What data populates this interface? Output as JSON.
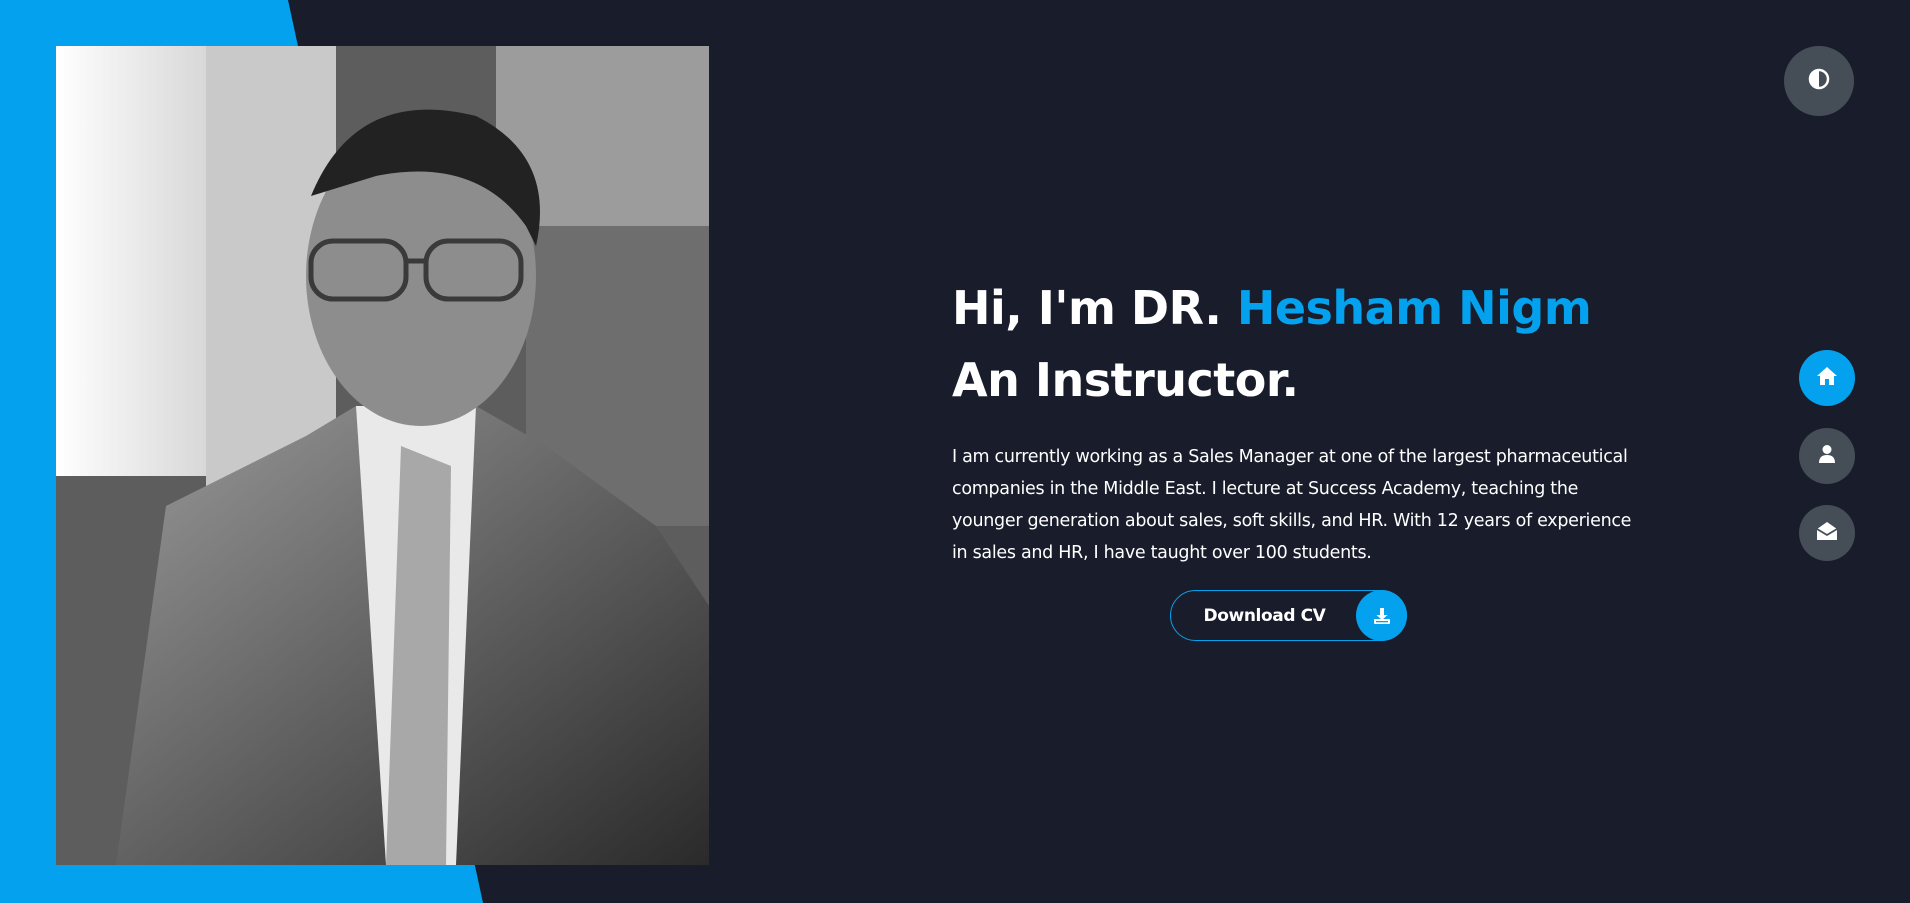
{
  "hero": {
    "greeting": "Hi, I'm DR. ",
    "name": "Hesham Nigm",
    "role": "An Instructor.",
    "bio": "I am currently working as a Sales Manager at one of the largest pharmaceutical companies in the Middle East. I lecture at Success Academy, teaching the younger generation about sales, soft skills, and HR. With 12 years of experience in sales and HR, I have taught over 100 students."
  },
  "download_button": {
    "label": "Download CV",
    "icon": "download-icon"
  },
  "theme_toggle": {
    "icon": "contrast-icon"
  },
  "nav": {
    "items": [
      {
        "icon": "home-icon",
        "active": true
      },
      {
        "icon": "user-icon",
        "active": false
      },
      {
        "icon": "envelope-open-icon",
        "active": false
      }
    ]
  },
  "colors": {
    "accent": "#04a2ee",
    "background": "#191d2b",
    "button_gray": "#454e56",
    "text": "#ffffff"
  }
}
